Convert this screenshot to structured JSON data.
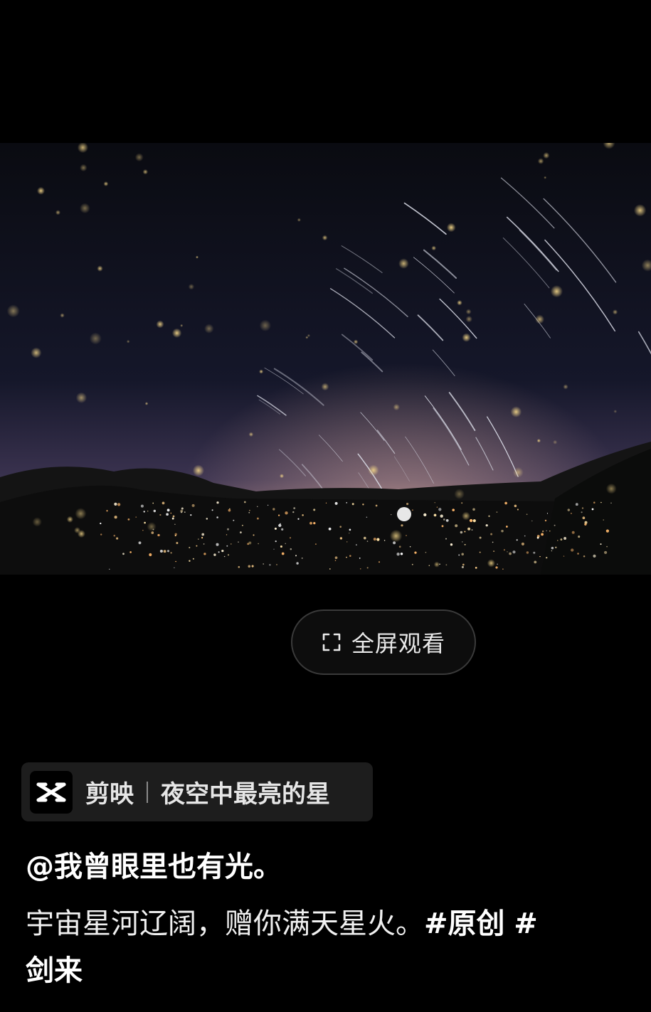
{
  "video": {
    "description_icon": "play-video"
  },
  "fullscreen": {
    "label": "全屏观看",
    "icon": "fullscreen-icon"
  },
  "capcut": {
    "logo_icon": "capcut-logo-icon",
    "app_name": "剪映",
    "template_name": "夜空中最亮的星"
  },
  "post": {
    "author": "@我曾眼里也有光。",
    "caption_text": "宇宙星河辽阔，赠你满天星火。",
    "hashtags": [
      "#原创",
      "#剑来"
    ]
  }
}
